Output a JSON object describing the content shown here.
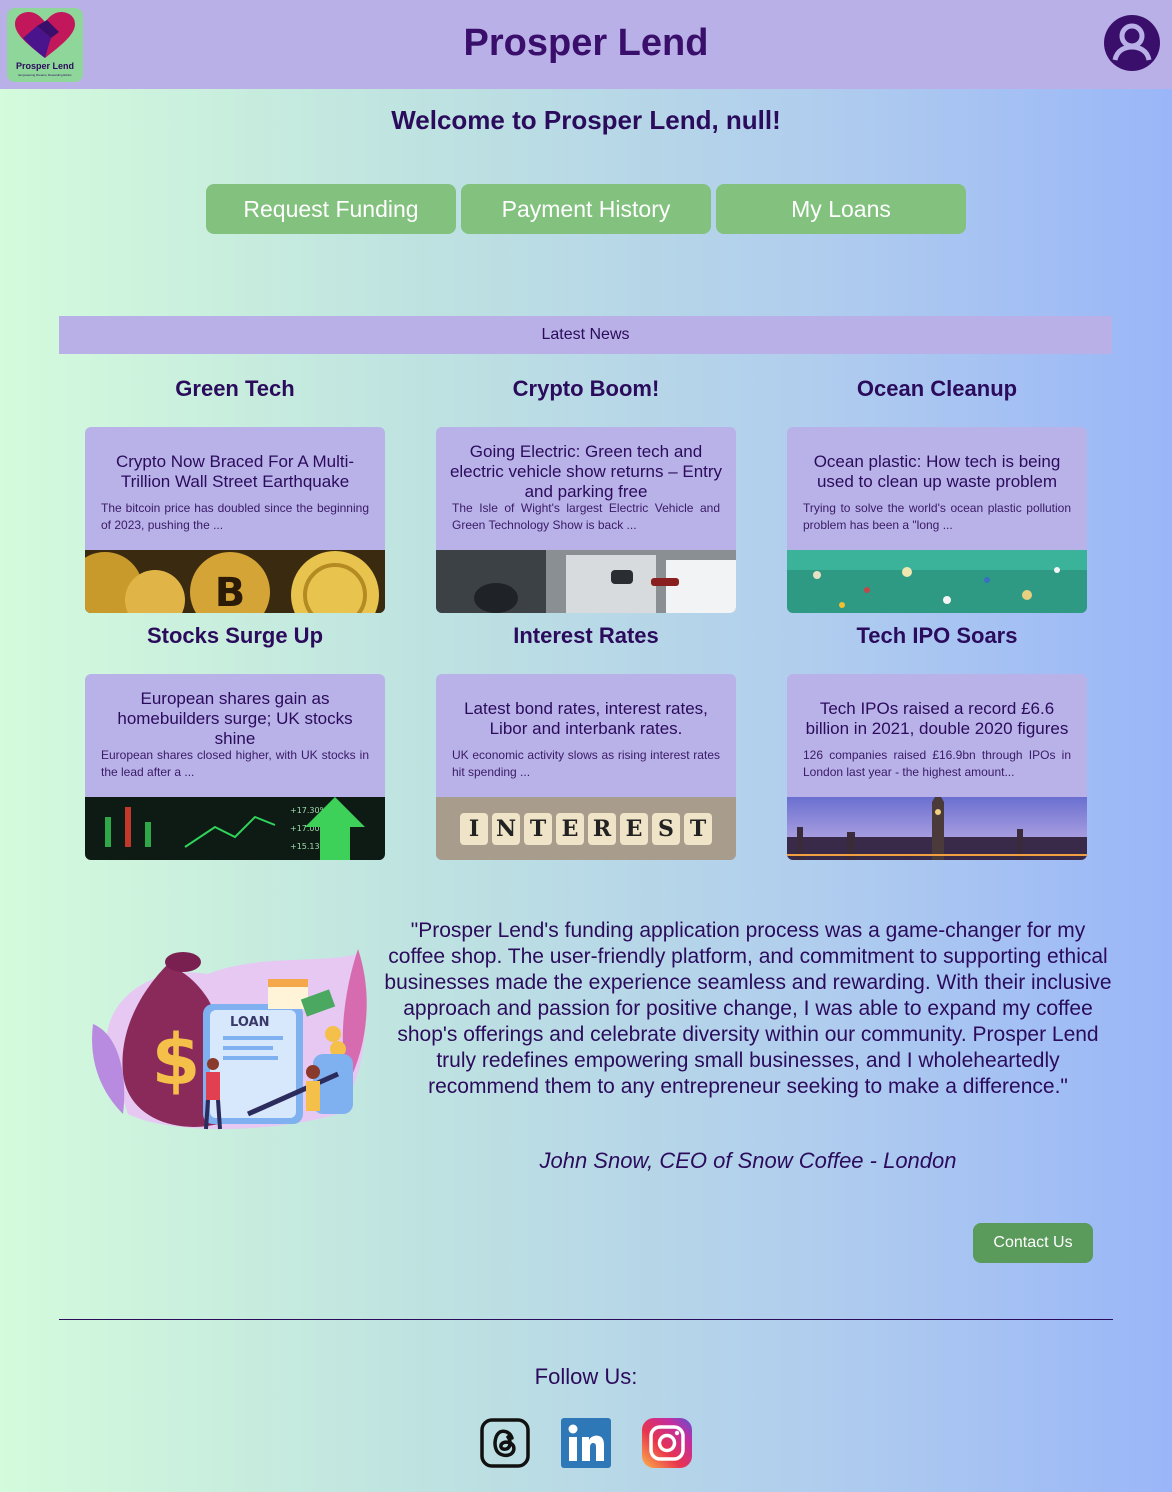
{
  "header": {
    "logo_text": "Prosper Lend",
    "logo_tagline": "Empowering Dreams, Rewarding Ethics",
    "title": "Prosper Lend",
    "avatar_icon": "user-avatar-icon"
  },
  "welcome": "Welcome to Prosper Lend, null!",
  "nav": {
    "request_funding": "Request Funding",
    "payment_history": "Payment History",
    "my_loans": "My Loans"
  },
  "news": {
    "heading": "Latest News",
    "items": [
      {
        "title": "Green Tech",
        "headline": "Crypto Now Braced For A Multi-Trillion Wall Street Earthquake",
        "summary": "The bitcoin price has doubled since the beginning of 2023, pushing the ..."
      },
      {
        "title": "Crypto Boom!",
        "headline": "Going Electric: Green tech and electric vehicle show returns – Entry and parking free",
        "summary": "The Isle of Wight's largest Electric Vehicle and Green Technology Show is back ..."
      },
      {
        "title": "Ocean Cleanup",
        "headline": "Ocean plastic: How tech is being used to clean up waste problem",
        "summary": "Trying to solve the world's ocean plastic pollution problem has been a \"long ..."
      },
      {
        "title": "Stocks Surge Up",
        "headline": "European shares gain as homebuilders surge; UK stocks shine",
        "summary": "European shares closed higher, with UK stocks in the lead after a ..."
      },
      {
        "title": "Interest Rates",
        "headline": "Latest bond rates, interest rates, Libor and interbank rates.",
        "summary": "UK economic activity slows as rising interest rates hit spending ..."
      },
      {
        "title": "Tech IPO Soars",
        "headline": "Tech IPOs raised a record £6.6 billion in 2021, double 2020 figures",
        "summary": "126 companies raised £16.9bn through IPOs in London last year - the highest amount..."
      }
    ],
    "interest_word": "INTEREST",
    "chart_labels": [
      "+17.30%",
      "+17.00%",
      "+15.13%"
    ],
    "loan_label": "LOAN"
  },
  "testimonial": {
    "quote": "\"Prosper Lend's funding application process was a game-changer for my coffee shop. The user-friendly platform, and commitment to supporting ethical businesses made the experience seamless and rewarding. With their inclusive approach and passion for positive change, I was able to expand my coffee shop's offerings and celebrate diversity within our community. Prosper Lend truly redefines empowering small businesses, and I wholeheartedly recommend them to any entrepreneur seeking to make a difference.\"",
    "author": "John Snow, CEO of Snow Coffee - London"
  },
  "contact_label": "Contact Us",
  "footer": {
    "follow": "Follow Us:",
    "icons": [
      "threads-icon",
      "linkedin-icon",
      "instagram-icon"
    ]
  },
  "colors": {
    "header_bg": "#b8b0e6",
    "button_green": "#82c17e",
    "contact_green": "#5a9a5a",
    "text_purple": "#2b0b5c"
  }
}
